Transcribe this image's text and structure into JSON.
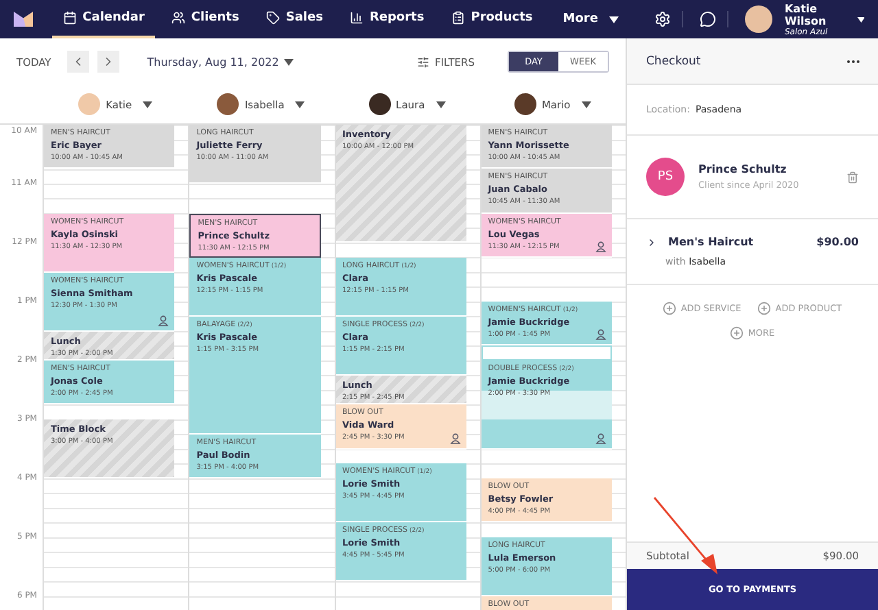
{
  "nav": {
    "items": [
      {
        "label": "Calendar",
        "selected": true
      },
      {
        "label": "Clients",
        "selected": false
      },
      {
        "label": "Sales",
        "selected": false
      },
      {
        "label": "Reports",
        "selected": false
      },
      {
        "label": "Products",
        "selected": false
      }
    ],
    "more": "More",
    "user": {
      "name": "Katie Wilson",
      "salon": "Salon Azul"
    }
  },
  "toolbar": {
    "today": "TODAY",
    "date": "Thursday, Aug 11, 2022",
    "filters": "FILTERS",
    "views": [
      {
        "label": "DAY",
        "selected": true
      },
      {
        "label": "WEEK",
        "selected": false
      }
    ]
  },
  "hours": [
    "10 AM",
    "11 AM",
    "12 PM",
    "1 PM",
    "2 PM",
    "3 PM",
    "4 PM",
    "5 PM",
    "6 PM"
  ],
  "staff": [
    {
      "name": "Katie",
      "appointments": [
        {
          "kind": "appointment",
          "service": "MEN'S HAIRCUT",
          "client": "Eric Bayer",
          "time": "10:00 AM - 10:45 AM",
          "color": "#d9d9d9",
          "selected": false
        },
        {
          "kind": "appointment",
          "service": "WOMEN'S HAIRCUT",
          "client": "Kayla Osinski",
          "time": "11:30 AM - 12:30 PM",
          "color": "#f8c5dc",
          "selected": false
        },
        {
          "kind": "appointment",
          "service": "WOMEN'S HAIRCUT",
          "client": "Sienna Smitham",
          "time": "12:30 PM - 1:30 PM",
          "color": "#9ddbde",
          "selected": false,
          "flagged": true
        },
        {
          "kind": "block",
          "title": "Lunch",
          "time": "1:30 PM - 2:00 PM"
        },
        {
          "kind": "appointment",
          "service": "MEN'S HAIRCUT",
          "client": "Jonas Cole",
          "time": "2:00 PM - 2:45 PM",
          "color": "#9ddbde",
          "selected": false
        },
        {
          "kind": "block",
          "title": "Time Block",
          "time": "3:00 PM - 4:00 PM"
        }
      ]
    },
    {
      "name": "Isabella",
      "appointments": [
        {
          "kind": "appointment",
          "service": "LONG HAIRCUT",
          "client": "Juliette Ferry",
          "time": "10:00 AM - 11:00 AM",
          "color": "#d9d9d9",
          "selected": false
        },
        {
          "kind": "appointment",
          "service": "MEN'S HAIRCUT",
          "client": "Prince Schultz",
          "time": "11:30 AM - 12:15 PM",
          "color": "#f8c5dc",
          "selected": true
        },
        {
          "kind": "appointment",
          "service": "WOMEN'S HAIRCUT",
          "part": "(1/2)",
          "client": "Kris Pascale",
          "time": "12:15 PM - 1:15 PM",
          "color": "#9ddbde",
          "selected": false
        },
        {
          "kind": "appointment",
          "service": "BALAYAGE",
          "part": "(2/2)",
          "client": "Kris Pascale",
          "time": "1:15 PM - 3:15 PM",
          "color": "#9ddbde",
          "selected": false
        },
        {
          "kind": "appointment",
          "service": "MEN'S HAIRCUT",
          "client": "Paul Bodin",
          "time": "3:15 PM - 4:00 PM",
          "color": "#9ddbde",
          "selected": false
        }
      ]
    },
    {
      "name": "Laura",
      "appointments": [
        {
          "kind": "block",
          "title": "Inventory",
          "time": "10:00 AM - 12:00 PM"
        },
        {
          "kind": "appointment",
          "service": "LONG HAIRCUT",
          "part": "(1/2)",
          "client": "Clara",
          "time": "12:15 PM - 1:15 PM",
          "color": "#9ddbde",
          "selected": false
        },
        {
          "kind": "appointment",
          "service": "SINGLE PROCESS",
          "part": "(2/2)",
          "client": "Clara",
          "time": "1:15 PM - 2:15 PM",
          "color": "#9ddbde",
          "selected": false
        },
        {
          "kind": "block",
          "title": "Lunch",
          "time": "2:15 PM - 2:45 PM"
        },
        {
          "kind": "appointment",
          "service": "BLOW OUT",
          "client": "Vida Ward",
          "time": "2:45 PM - 3:30 PM",
          "color": "#fbdfc7",
          "selected": false,
          "flagged": true
        },
        {
          "kind": "appointment",
          "service": "WOMEN'S HAIRCUT",
          "part": "(1/2)",
          "client": "Lorie Smith",
          "time": "3:45 PM - 4:45 PM",
          "color": "#9ddbde",
          "selected": false
        },
        {
          "kind": "appointment",
          "service": "SINGLE PROCESS",
          "part": "(2/2)",
          "client": "Lorie Smith",
          "time": "4:45 PM - 5:45 PM",
          "color": "#9ddbde",
          "selected": false
        }
      ]
    },
    {
      "name": "Mario",
      "appointments": [
        {
          "kind": "appointment",
          "service": "MEN'S HAIRCUT",
          "client": "Yann Morissette",
          "time": "10:00 AM - 10:45 AM",
          "color": "#d9d9d9",
          "selected": false
        },
        {
          "kind": "appointment",
          "service": "MEN'S HAIRCUT",
          "client": "Juan Cabalo",
          "time": "10:45 AM - 11:30 AM",
          "color": "#d9d9d9",
          "selected": false
        },
        {
          "kind": "appointment",
          "service": "WOMEN'S HAIRCUT",
          "client": "Lou Vegas",
          "time": "11:30 AM - 12:15 PM",
          "color": "#f8c5dc",
          "selected": false,
          "flagged": true
        },
        {
          "kind": "appointment",
          "service": "WOMEN'S HAIRCUT",
          "part": "(1/2)",
          "client": "Jamie Buckridge",
          "time": "1:00 PM - 1:45 PM",
          "color": "#9ddbde",
          "selected": false,
          "flagged": true
        },
        {
          "kind": "empty"
        },
        {
          "kind": "appointment",
          "service": "DOUBLE PROCESS",
          "part": "(2/2)",
          "client": "Jamie Buckridge",
          "time": "2:00 PM - 3:30 PM",
          "color": "#9ddbde",
          "selected": false,
          "flagged": true,
          "processing": true
        },
        {
          "kind": "appointment",
          "service": "BLOW OUT",
          "client": "Betsy Fowler",
          "time": "4:00 PM - 4:45 PM",
          "color": "#fbdfc7",
          "selected": false
        },
        {
          "kind": "appointment",
          "service": "LONG HAIRCUT",
          "client": "Lula Emerson",
          "time": "5:00 PM - 6:00 PM",
          "color": "#9ddbde",
          "selected": false
        },
        {
          "kind": "appointment",
          "service": "BLOW OUT",
          "color": "#fbdfc7",
          "selected": false
        }
      ]
    }
  ],
  "checkout": {
    "title": "Checkout",
    "location_label": "Location:",
    "location": "Pasadena",
    "client": {
      "initials": "PS",
      "name": "Prince Schultz",
      "since": "Client since April 2020"
    },
    "service": {
      "name": "Men's Haircut",
      "price": "$90.00",
      "with_label": "with",
      "stylist": "Isabella"
    },
    "actions": [
      "ADD SERVICE",
      "ADD PRODUCT",
      "MORE"
    ],
    "subtotal_label": "Subtotal",
    "subtotal": "$90.00",
    "button": "GO TO PAYMENTS"
  }
}
